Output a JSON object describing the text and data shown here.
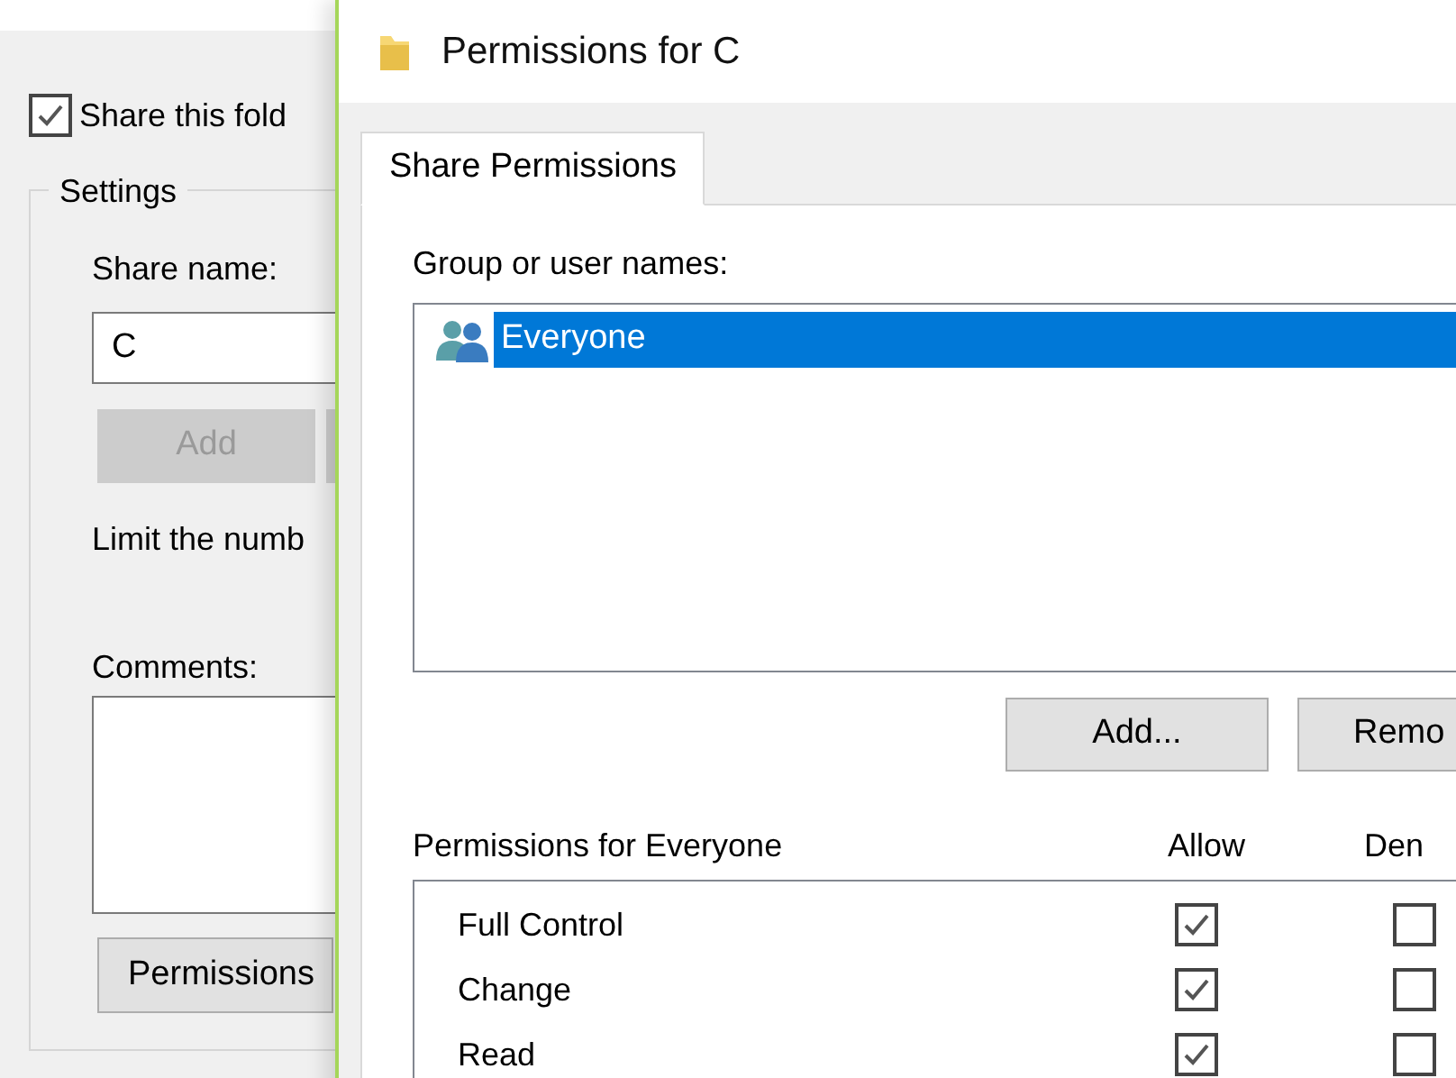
{
  "background_dialog": {
    "share_checkbox": {
      "label": "Share this fold",
      "checked": true
    },
    "settings_group": {
      "title": "Settings",
      "share_name_label": "Share name:",
      "share_name_value": "C",
      "add_button": {
        "label": "Add",
        "disabled": true
      },
      "limit_text": "Limit the numb",
      "comments_label": "Comments:",
      "permissions_button": {
        "label": "Permissions",
        "disabled": false
      }
    }
  },
  "permissions_dialog": {
    "title": "Permissions for C",
    "tabs": [
      {
        "label": "Share Permissions",
        "selected": true
      }
    ],
    "group_label": "Group or user names:",
    "users": [
      {
        "name": "Everyone",
        "selected": true
      }
    ],
    "buttons": [
      "Add...",
      "Remo"
    ],
    "permissions_label": "Permissions for Everyone",
    "columns": [
      "Allow",
      "Den"
    ],
    "permissions": [
      {
        "name": "Full Control",
        "allow": true,
        "deny": false
      },
      {
        "name": "Change",
        "allow": true,
        "deny": false
      },
      {
        "name": "Read",
        "allow": true,
        "deny": false
      }
    ]
  }
}
